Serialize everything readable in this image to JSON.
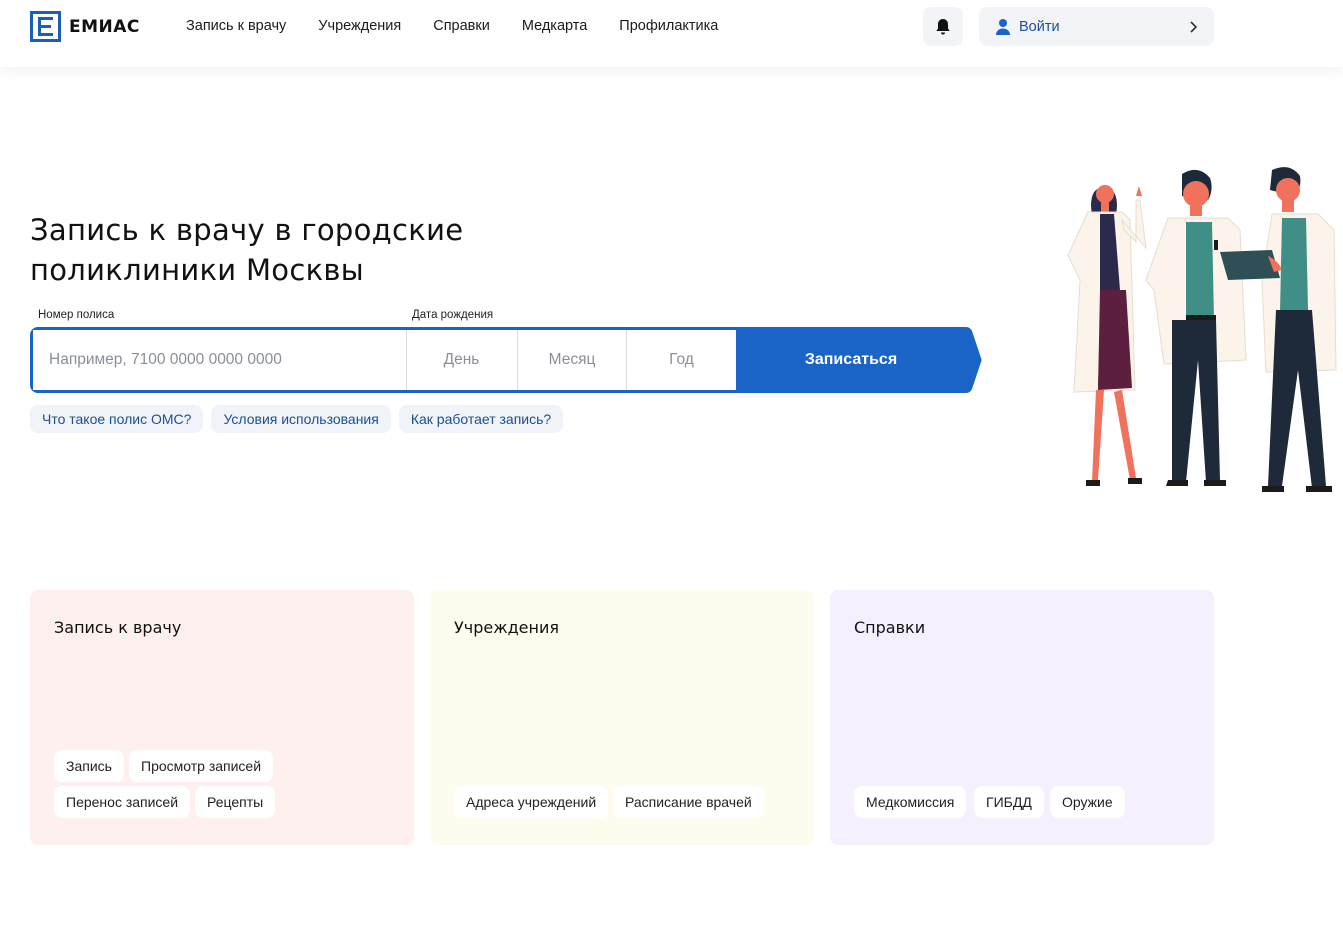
{
  "header": {
    "logo_text": "ЕМИАС",
    "nav": [
      "Запись к врачу",
      "Учреждения",
      "Справки",
      "Медкарта",
      "Профилактика"
    ],
    "login_label": "Войти"
  },
  "hero": {
    "title_line1": "Запись к врачу в городские",
    "title_line2": "поликлиники Москвы"
  },
  "form": {
    "policy_label": "Номер полиса",
    "policy_placeholder": "Например, 7100 0000 0000 0000",
    "birth_label": "Дата рождения",
    "day_placeholder": "День",
    "month_placeholder": "Месяц",
    "year_placeholder": "Год",
    "submit_label": "Записаться"
  },
  "help_links": [
    "Что такое полис ОМС?",
    "Условия использования",
    "Как работает запись?"
  ],
  "cards": [
    {
      "title": "Запись к врачу",
      "tags": [
        "Запись",
        "Просмотр записей",
        "Перенос записей",
        "Рецепты"
      ]
    },
    {
      "title": "Учреждения",
      "tags": [
        "Адреса учреждений",
        "Расписание врачей"
      ]
    },
    {
      "title": "Справки",
      "tags": [
        "Медкомиссия",
        "ГИБДД",
        "Оружие"
      ]
    }
  ],
  "colors": {
    "accent": "#1a63c7",
    "card_appointment": "#fdf0ee",
    "card_institutions": "#fefcef",
    "card_certificates": "#f5effe"
  }
}
